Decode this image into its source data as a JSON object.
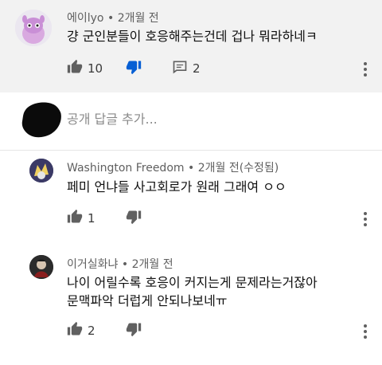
{
  "main_comment": {
    "author": "에이lyo",
    "time": "2개월 전",
    "text": "걍 군인분들이 호응해주는건데 겁나 뭐라하네ㅋ",
    "likes": "10",
    "replies": "2"
  },
  "reply_input": {
    "placeholder": "공개 답글 추가..."
  },
  "replies": [
    {
      "author": "Washington Freedom",
      "time": "2개월 전(수정됨)",
      "lines": [
        "페미 언냐들 사고회로가 원래 그래여 ㅇㅇ"
      ],
      "likes": "1"
    },
    {
      "author": "이거실화냐",
      "time": "2개월 전",
      "lines": [
        "나이 어릴수록 호응이 커지는게 문제라는거잖아",
        "문맥파악 더럽게 안되나보네ㅠ"
      ],
      "likes": "2"
    }
  ],
  "colors": {
    "highlight_bg": "#f2f2f2",
    "dislike_active": "#065fd4",
    "icon_gray": "#606060"
  }
}
